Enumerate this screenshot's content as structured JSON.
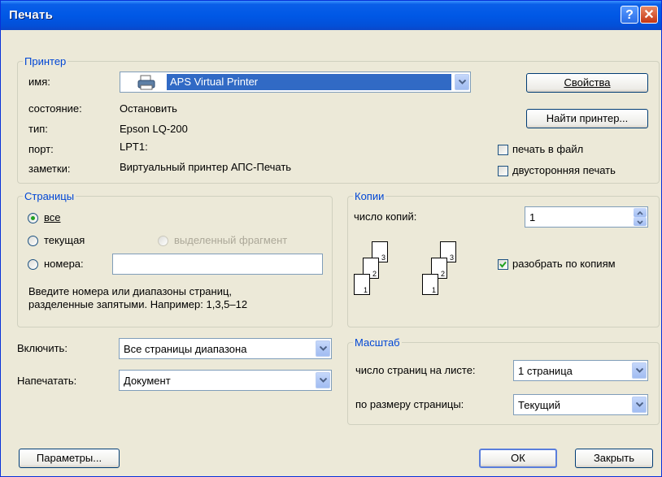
{
  "window": {
    "title": "Печать"
  },
  "printer": {
    "group_title": "Принтер",
    "name_label": "имя:",
    "name_value": "APS Virtual Printer",
    "status_label": "состояние:",
    "status_value": "Остановить",
    "type_label": "тип:",
    "type_value": "Epson LQ-200",
    "port_label": "порт:",
    "port_value": "LPT1:",
    "notes_label": "заметки:",
    "notes_value": "Виртуальный принтер АПС-Печать",
    "properties_button": "Свойства",
    "find_button": "Найти принтер...",
    "print_to_file": "печать в файл",
    "duplex": "двусторонняя печать"
  },
  "pages": {
    "group_title": "Страницы",
    "all": "все",
    "current": "текущая",
    "selection": "выделенный фрагмент",
    "numbers": "номера:",
    "numbers_value": "",
    "hint_line1": "Введите номера или диапазоны страниц,",
    "hint_line2": "разделенные запятыми. Например: 1,3,5–12",
    "selected": "all"
  },
  "copies": {
    "group_title": "Копии",
    "count_label": "число копий:",
    "count_value": "1",
    "collate": "разобрать по копиям",
    "collate_checked": true,
    "page_numbers": [
      "1",
      "2",
      "3"
    ]
  },
  "include": {
    "label": "Включить:",
    "value": "Все страницы диапазона"
  },
  "print_what": {
    "label": "Напечатать:",
    "value": "Документ"
  },
  "zoom": {
    "group_title": "Масштаб",
    "pages_per_sheet_label": "число страниц на листе:",
    "pages_per_sheet_value": "1 страница",
    "scale_label": "по размеру страницы:",
    "scale_value": "Текущий"
  },
  "footer": {
    "options_button": "Параметры...",
    "ok_button": "ОК",
    "close_button": "Закрыть"
  },
  "colors": {
    "title_bar": "#0058e6",
    "group_title": "#0046d5",
    "selection": "#316ac5",
    "dialog_bg": "#ece9d8"
  },
  "icons": [
    "help-icon",
    "close-icon",
    "printer-icon",
    "chevron-down-icon",
    "spin-up-icon",
    "spin-down-icon",
    "checkmark-icon",
    "collated-pages-icon"
  ]
}
